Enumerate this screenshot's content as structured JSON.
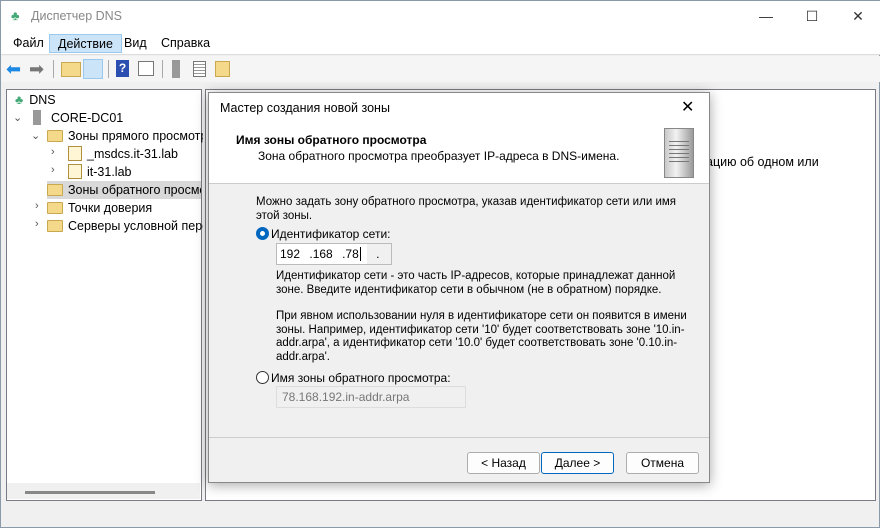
{
  "window": {
    "title": "Диспетчер DNS"
  },
  "menu": [
    "Файл",
    "Действие",
    "Вид",
    "Справка"
  ],
  "tree": {
    "root": "DNS",
    "server": "CORE-DC01",
    "items": [
      "Зоны прямого просмотра",
      "_msdcs.it-31.lab",
      "it-31.lab",
      "Зоны обратного просмотра",
      "Точки доверия",
      "Серверы условной пересылки"
    ]
  },
  "right_text": "ацию об одном или",
  "dialog": {
    "title": "Мастер создания новой зоны",
    "header": "Имя зоны обратного просмотра",
    "subheader": "Зона обратного просмотра преобразует IP-адреса в DNS-имена.",
    "intro": "Можно задать зону обратного просмотра, указав идентификатор сети или имя этой зоны.",
    "radio_network": "Идентификатор сети:",
    "octets": [
      "192",
      ".168",
      ".78",
      "."
    ],
    "help1": "Идентификатор сети - это часть IP-адресов, которые принадлежат данной зоне. Введите идентификатор сети в обычном (не в обратном) порядке.",
    "help2": "При явном использовании нуля в идентификаторе сети он появится в имени зоны. Например, идентификатор сети '10' будет соответствовать зоне '10.in-addr.arpa', а идентификатор сети '10.0' будет соответствовать зоне '0.10.in-addr.arpa'.",
    "radio_zone": "Имя зоны обратного просмотра:",
    "zone_name": "78.168.192.in-addr.arpa",
    "back": "< Назад",
    "next": "Далее >",
    "cancel": "Отмена"
  }
}
